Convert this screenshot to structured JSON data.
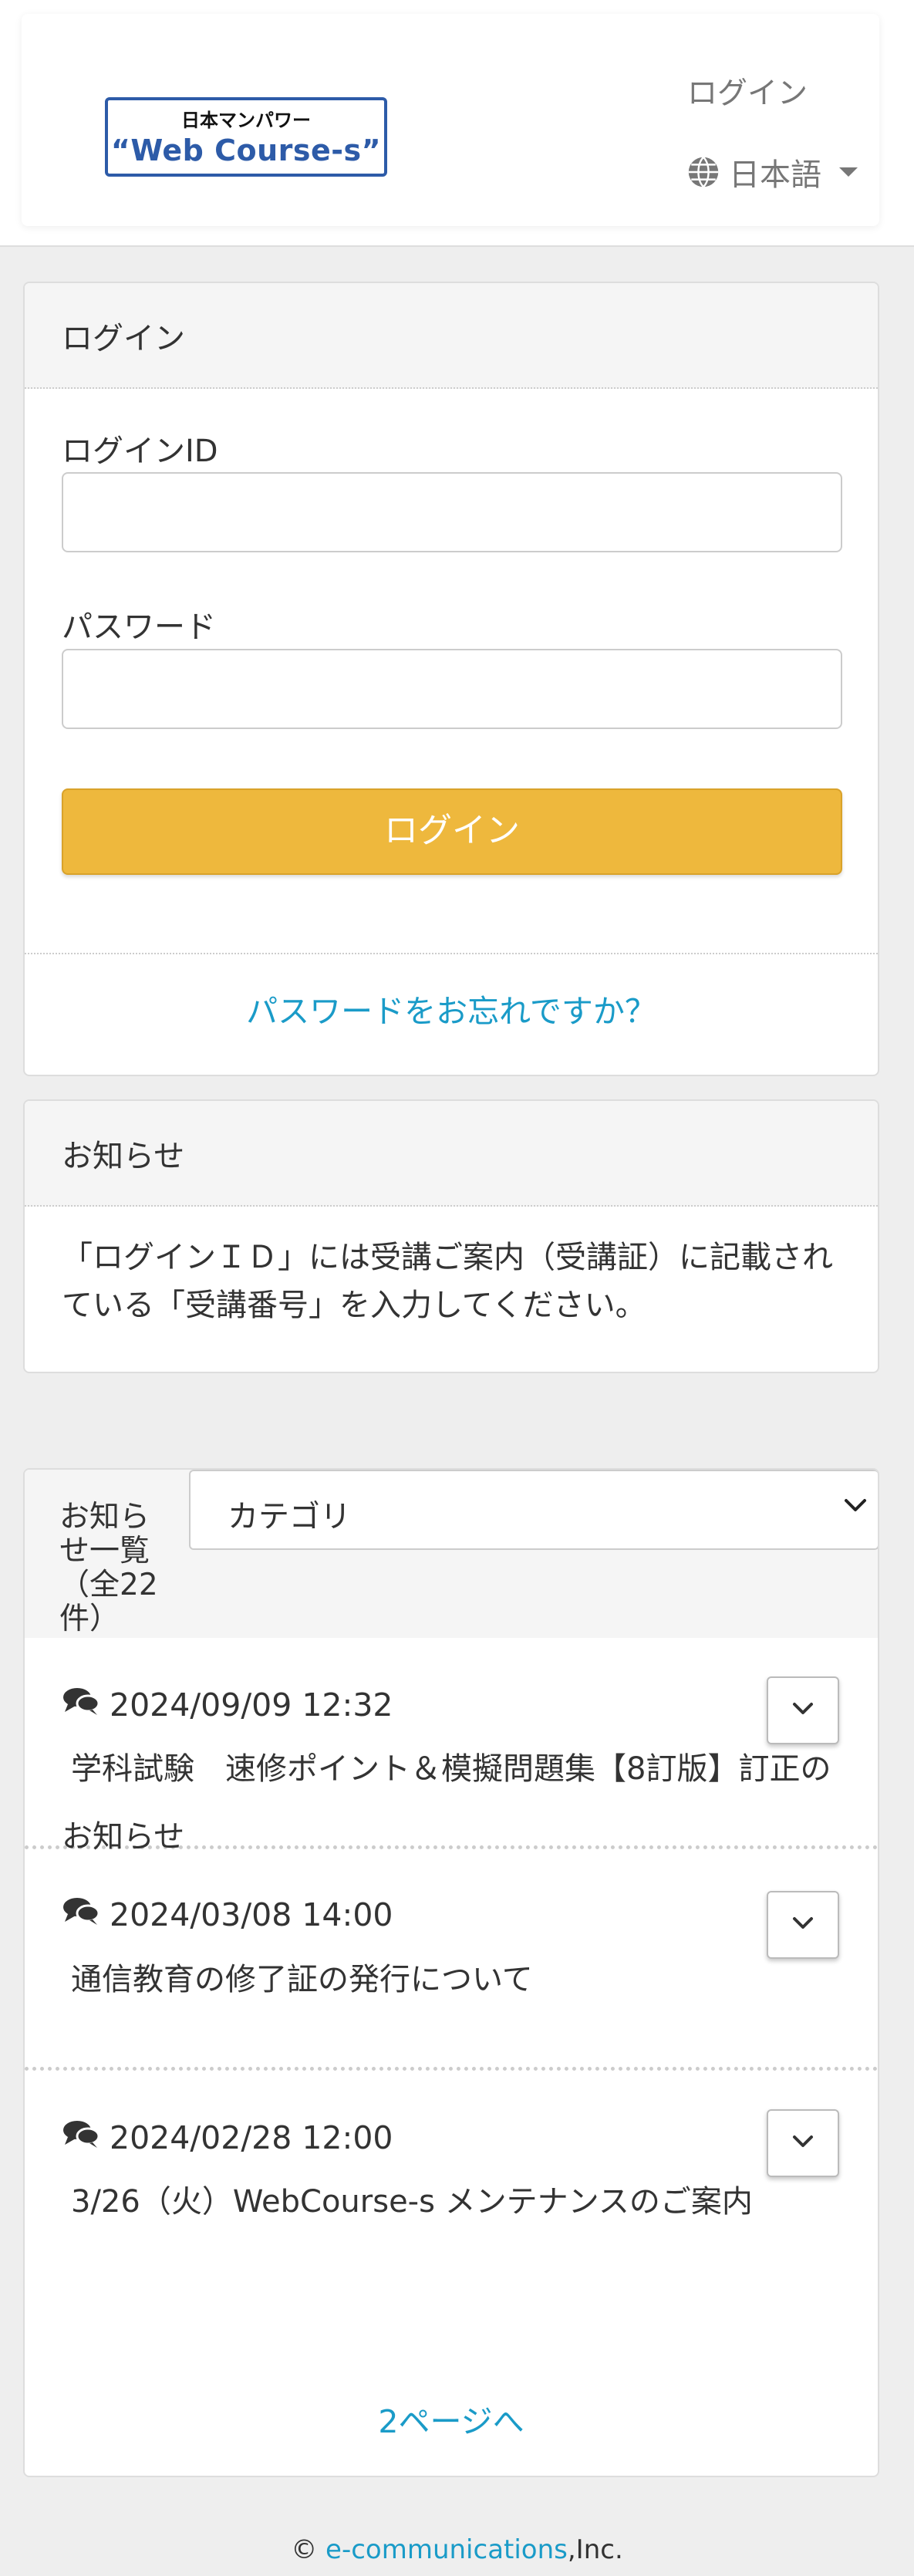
{
  "header": {
    "logo_top": "日本マンパワー",
    "logo_main": "“Web Course-s”",
    "login_link": "ログイン",
    "language": "日本語"
  },
  "login_panel": {
    "title": "ログイン",
    "login_id_label": "ログインID",
    "login_id_value": "",
    "password_label": "パスワード",
    "password_value": "",
    "login_button": "ログイン",
    "forgot_password": "パスワードをお忘れですか？"
  },
  "notice_panel": {
    "title": "お知らせ",
    "body": "「ログインＩＤ」には受講ご案内（受講証）に記載されている「受講番号」を入力してください。"
  },
  "news_panel": {
    "title": "お知らせ一覧（全22件）",
    "category_selected": "カテゴリ",
    "items": [
      {
        "date": "2024/09/09 12:32",
        "text": "学科試験　速修ポイント＆模擬問題集【8訂版】訂正のお知らせ"
      },
      {
        "date": "2024/03/08 14:00",
        "text": "通信教育の修了証の発行について"
      },
      {
        "date": "2024/02/28 12:00",
        "text": "3/26（火）WebCourse-s メンテナンスのご案内"
      }
    ],
    "next_page": "2ページへ"
  },
  "footer": {
    "copyright": "©",
    "company_link": "e-communications",
    "suffix": ",Inc."
  },
  "colors": {
    "accent_button": "#eeb83d",
    "link": "#1a9bc8",
    "logo_blue": "#2d5ba8",
    "panel_head": "#f5f5f5",
    "background": "#eeeeee"
  },
  "icons": {
    "language": "globe-icon",
    "language_caret": "caret-down-icon",
    "news_item": "comments-icon",
    "expand": "chevron-down-icon",
    "select": "chevron-down-icon"
  }
}
